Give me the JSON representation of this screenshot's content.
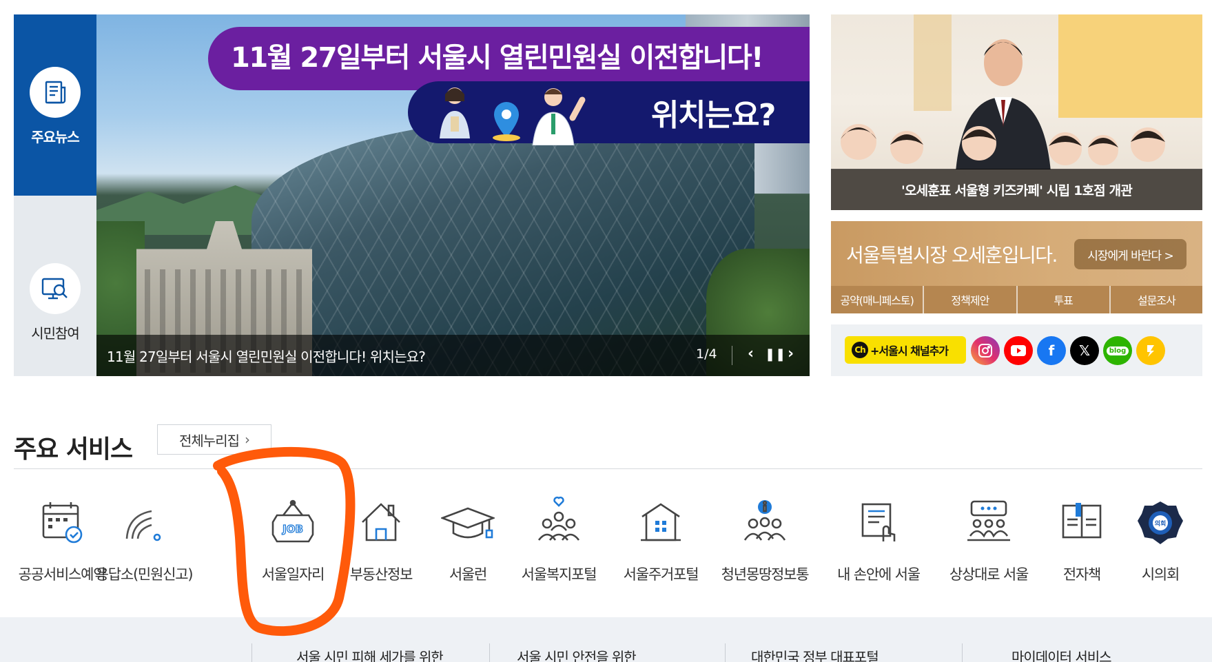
{
  "side_tabs": [
    {
      "label": "주요뉴스",
      "icon": "newspaper-icon",
      "active": true
    },
    {
      "label": "시민참여",
      "icon": "monitor-search-icon",
      "active": false
    }
  ],
  "banner": {
    "headline_top": "11월 27일부터 서울시 열린민원실 이전합니다!",
    "headline_bottom": "위치는요?",
    "caption": "11월 27일부터 서울시 열린민원실 이전합니다! 위치는요?",
    "counter": "1/4",
    "prev_icon": "chevron-left-icon",
    "pause_icon": "pause-icon",
    "next_icon": "chevron-right-icon"
  },
  "news_card": {
    "caption": "'오세훈표 서울형 키즈카페' 시립 1호점 개관"
  },
  "mayor_card": {
    "title": "서울특별시장 오세훈입니다.",
    "button": "시장에게 바란다 >",
    "menu": [
      "공약(매니페스토)",
      "정책제안",
      "투표",
      "설문조사"
    ]
  },
  "sns": {
    "kakao_label": "+서울시 채널추가",
    "kakao_badge": "Ch",
    "icons": [
      {
        "name": "instagram-icon",
        "color": "#e1306c"
      },
      {
        "name": "youtube-icon",
        "color": "#ff0000"
      },
      {
        "name": "facebook-icon",
        "color": "#1877f2"
      },
      {
        "name": "x-icon",
        "color": "#000000"
      },
      {
        "name": "blog-icon",
        "color": "#2db400"
      },
      {
        "name": "kakaostory-icon",
        "color": "#ffc400"
      }
    ]
  },
  "services": {
    "title": "주요 서비스",
    "all_button": "전체누리집",
    "items": [
      {
        "label": "공공서비스예약",
        "icon": "calendar-check-icon"
      },
      {
        "label": "응답소(민원신고)",
        "icon": "signal-icon"
      },
      {
        "label": "서울일자리",
        "icon": "job-sign-icon"
      },
      {
        "label": "부동산정보",
        "icon": "house-icon"
      },
      {
        "label": "서울런",
        "icon": "graduation-cap-icon"
      },
      {
        "label": "서울복지포털",
        "icon": "people-heart-icon"
      },
      {
        "label": "서울주거포털",
        "icon": "building-icon"
      },
      {
        "label": "청년몽땅정보통",
        "icon": "youth-info-icon"
      },
      {
        "label": "내 손안에 서울",
        "icon": "hand-document-icon"
      },
      {
        "label": "상상대로 서울",
        "icon": "meeting-icon"
      },
      {
        "label": "전자책",
        "icon": "ebook-icon"
      },
      {
        "label": "시의회",
        "icon": "council-emblem-icon"
      }
    ]
  },
  "bottom_links": [
    "서울 시민 피해 세가를 위한",
    "서울 시민 안전을 위한",
    "대한민국 정부 대표포털",
    "마이데이터 서비스"
  ],
  "colors": {
    "primary_blue": "#0b55a5",
    "banner_purple": "#6b1fa0",
    "banner_navy": "#14196e",
    "annotation_orange": "#ff5a0a",
    "mayor_gold": "#c99a62"
  }
}
